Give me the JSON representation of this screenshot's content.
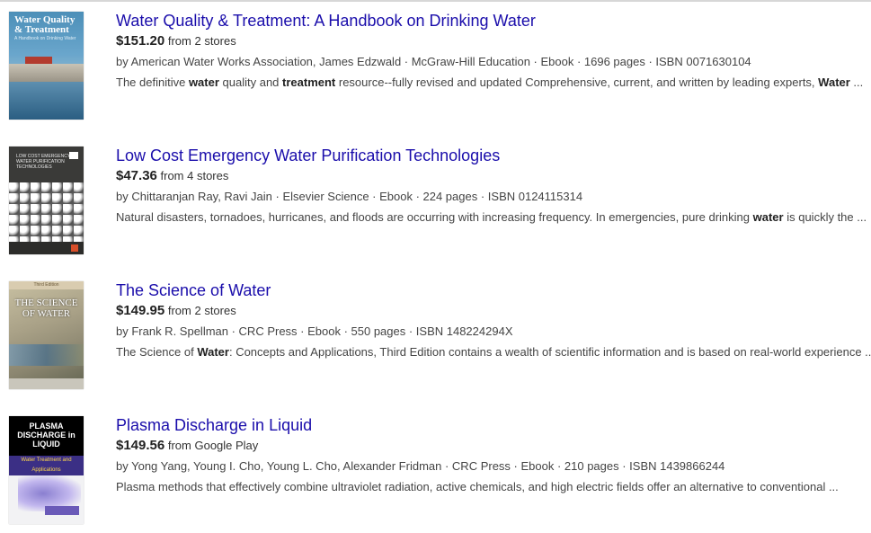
{
  "results": [
    {
      "title": "Water Quality & Treatment: A Handbook on Drinking Water",
      "price": "$151.20",
      "stores": "from 2 stores",
      "meta": "by American Water Works Association, James Edzwald · McGraw-Hill Education · Ebook · 1696 pages · ISBN 0071630104",
      "snippet": [
        {
          "text": "The definitive ",
          "bold": false
        },
        {
          "text": "water",
          "bold": true
        },
        {
          "text": " quality and ",
          "bold": false
        },
        {
          "text": "treatment",
          "bold": true
        },
        {
          "text": " resource--fully revised and updated Comprehensive, current, and written by leading experts, ",
          "bold": false
        },
        {
          "text": "Water",
          "bold": true
        },
        {
          "text": " ...",
          "bold": false
        }
      ],
      "cover": {
        "title": "Water Quality & Treatment",
        "subtitle": "A Handbook on Drinking Water"
      }
    },
    {
      "title": "Low Cost Emergency Water Purification Technologies",
      "price": "$47.36",
      "stores": "from 4 stores",
      "meta": "by Chittaranjan Ray, Ravi Jain · Elsevier Science · Ebook · 224 pages · ISBN 0124115314",
      "snippet": [
        {
          "text": "Natural disasters, tornadoes, hurricanes, and floods are occurring with increasing frequency. In emergencies, pure drinking ",
          "bold": false
        },
        {
          "text": "water",
          "bold": true
        },
        {
          "text": " is quickly the ...",
          "bold": false
        }
      ],
      "cover": {
        "title": "LOW COST EMERGENCY WATER PURIFICATION TECHNOLOGIES",
        "subtitle": ""
      }
    },
    {
      "title": "The Science of Water",
      "price": "$149.95",
      "stores": "from 2 stores",
      "meta": "by Frank R. Spellman · CRC Press · Ebook · 550 pages · ISBN 148224294X",
      "snippet": [
        {
          "text": "The Science of ",
          "bold": false
        },
        {
          "text": "Water",
          "bold": true
        },
        {
          "text": ": Concepts and Applications, Third Edition contains a wealth of scientific information and is based on real-world experience ...",
          "bold": false
        }
      ],
      "cover": {
        "title": "THE SCIENCE OF WATER",
        "subtitle": "Third Edition"
      }
    },
    {
      "title": "Plasma Discharge in Liquid",
      "price": "$149.56",
      "stores": "from Google Play",
      "meta": "by Yong Yang, Young I. Cho, Young L. Cho, Alexander Fridman · CRC Press · Ebook · 210 pages · ISBN 1439866244",
      "snippet": [
        {
          "text": "Plasma methods that effectively combine ultraviolet radiation, active chemicals, and high electric fields offer an alternative to conventional ...",
          "bold": false
        }
      ],
      "cover": {
        "title": "PLASMA DISCHARGE in LIQUID",
        "subtitle": "Water Treatment and Applications"
      }
    }
  ]
}
